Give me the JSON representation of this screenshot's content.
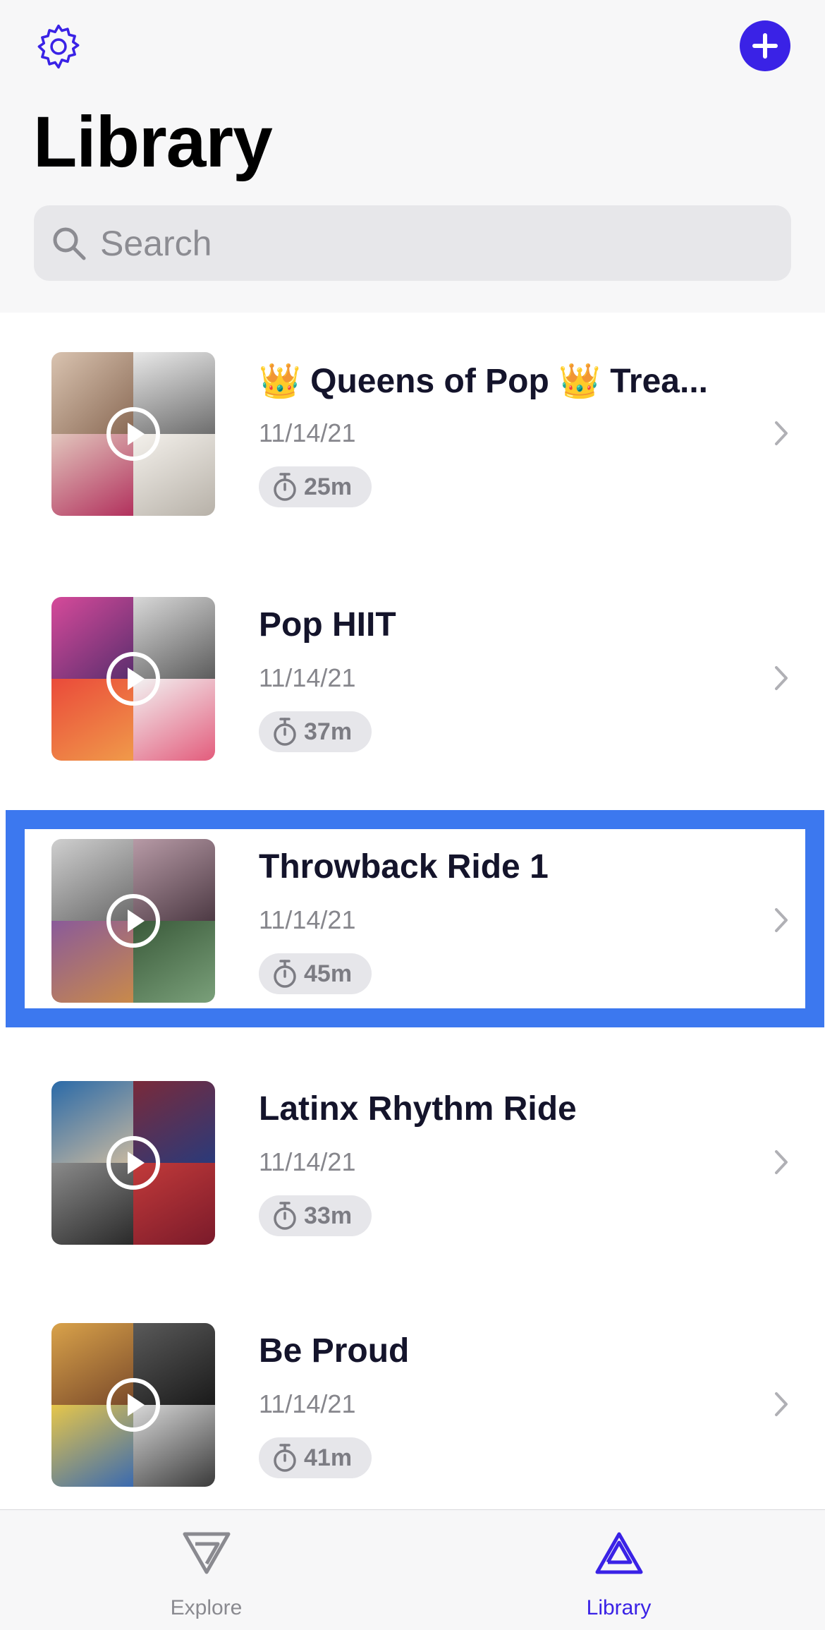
{
  "header": {
    "title": "Library",
    "settings_icon": "gear-icon",
    "add_icon": "plus-icon",
    "search_placeholder": "Search"
  },
  "playlists": [
    {
      "title": "👑 Queens of Pop 👑 Trea...",
      "date": "11/14/21",
      "duration": "25m"
    },
    {
      "title": "Pop HIIT",
      "date": "11/14/21",
      "duration": "37m"
    },
    {
      "title": "Throwback Ride 1",
      "date": "11/14/21",
      "duration": "45m",
      "highlighted": true
    },
    {
      "title": "Latinx Rhythm Ride",
      "date": "11/14/21",
      "duration": "33m"
    },
    {
      "title": "Be Proud",
      "date": "11/14/21",
      "duration": "41m"
    }
  ],
  "tabbar": {
    "tabs": [
      {
        "label": "Explore",
        "icon": "explore-icon",
        "active": false
      },
      {
        "label": "Library",
        "icon": "library-icon",
        "active": true
      }
    ]
  },
  "colors": {
    "accent": "#3a22e6",
    "highlight": "#3c78ef"
  }
}
